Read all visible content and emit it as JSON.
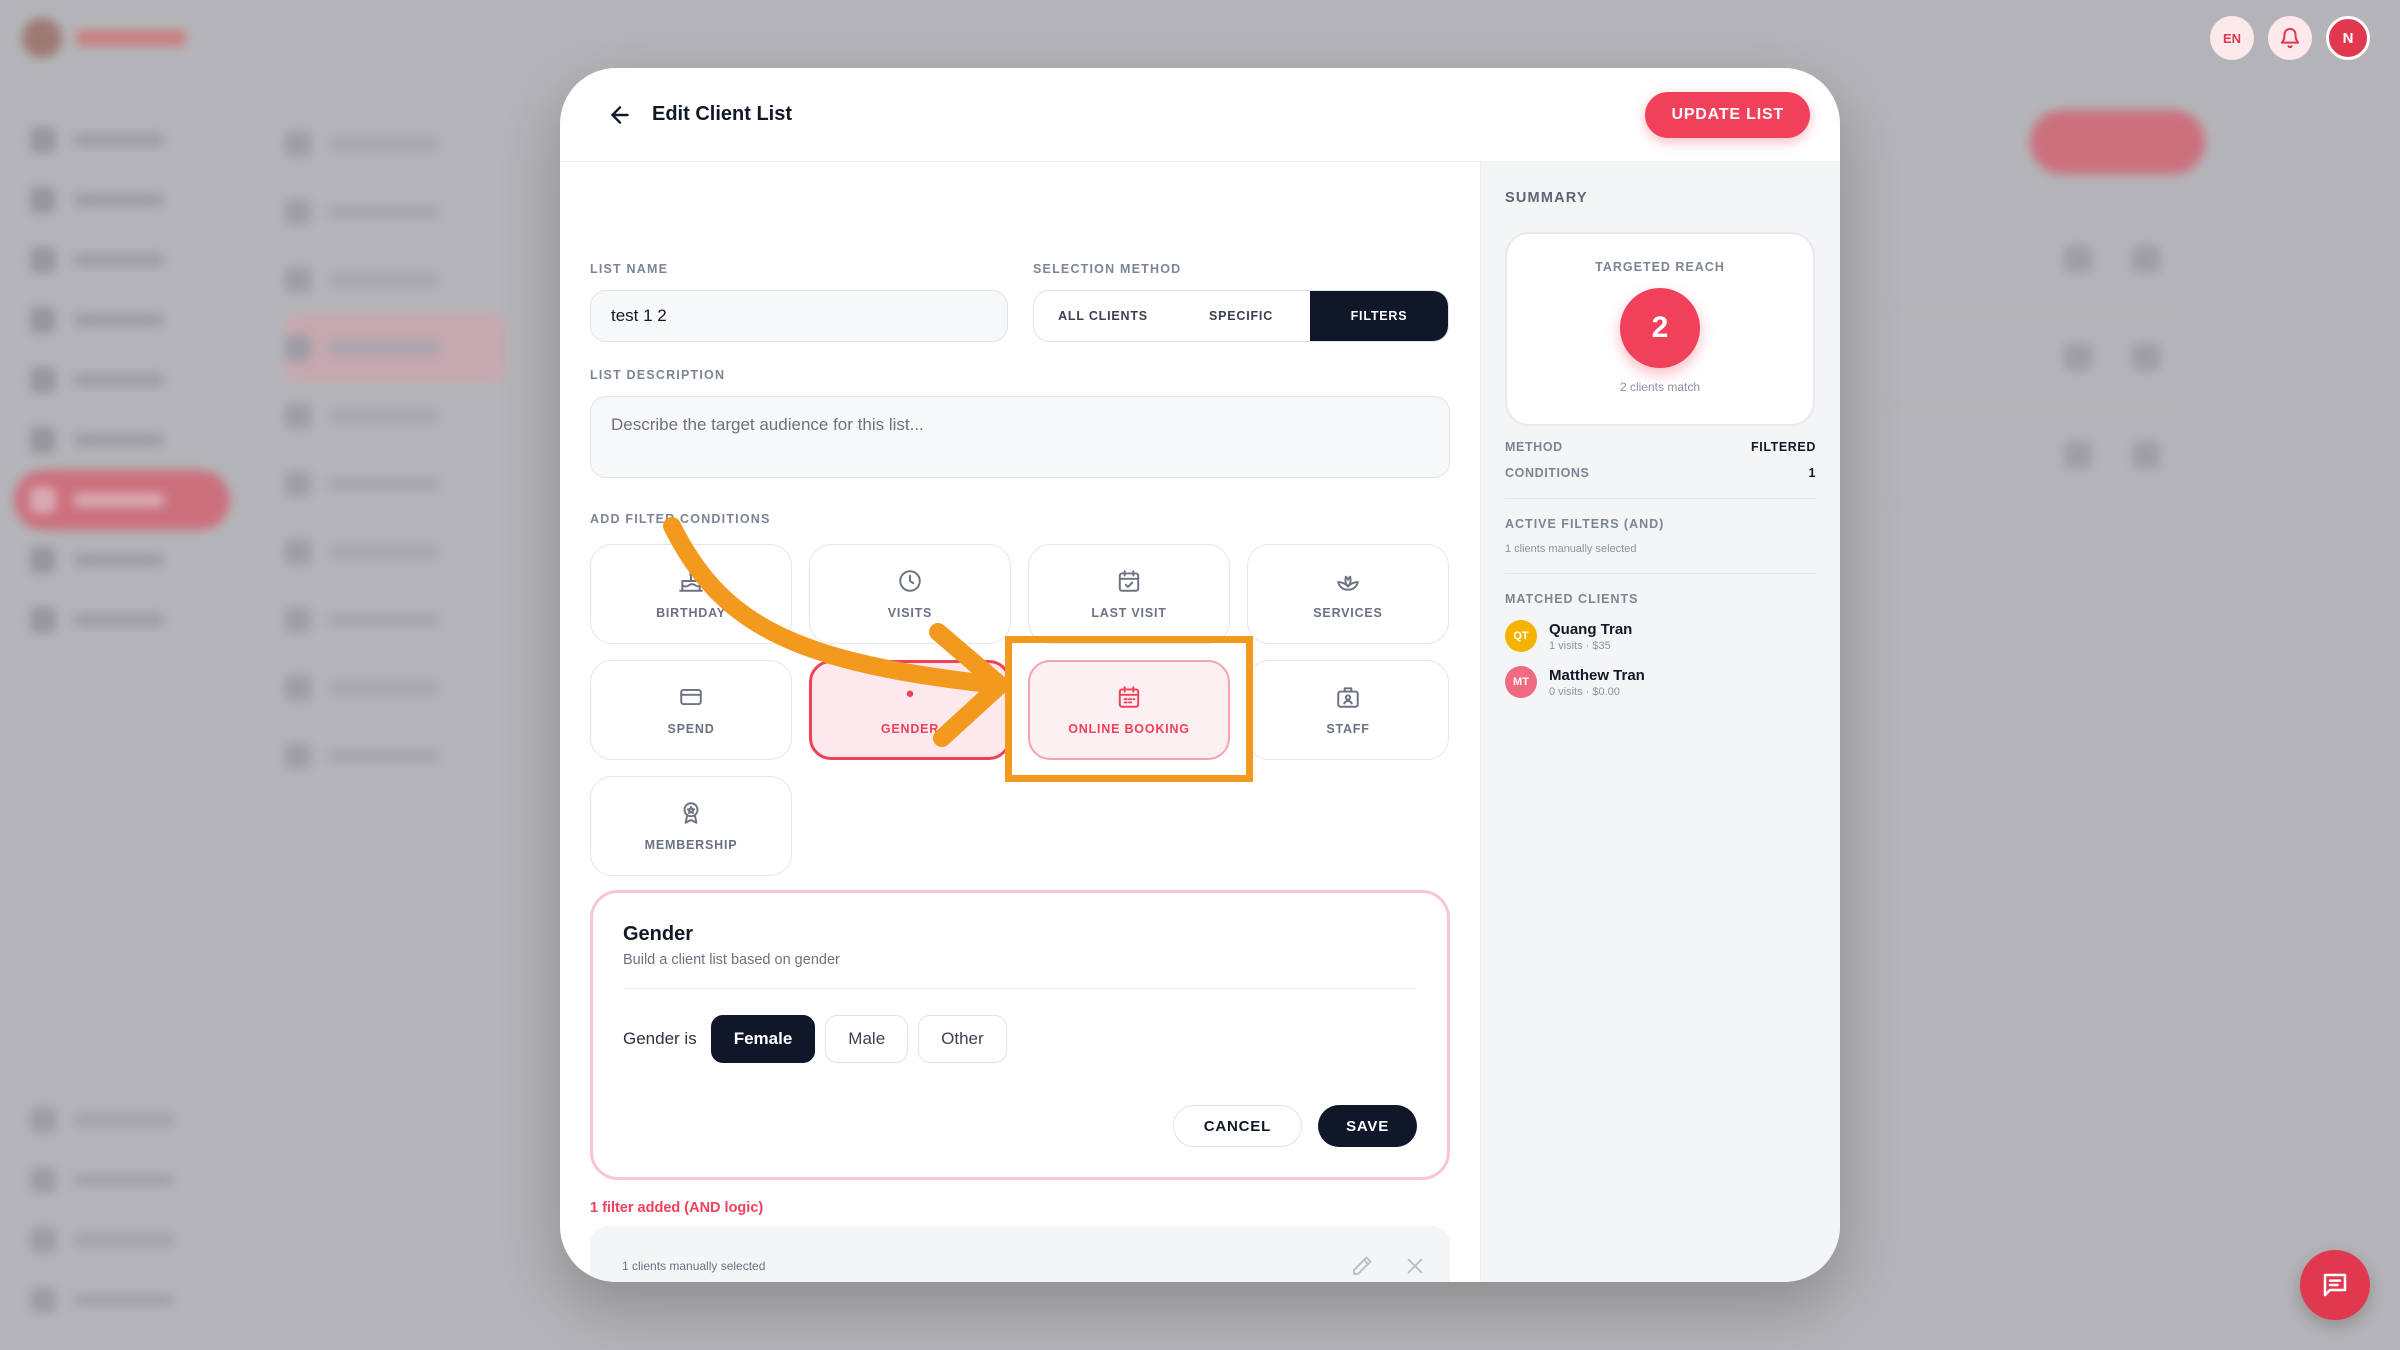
{
  "header": {
    "lang": "EN",
    "user_initial": "N"
  },
  "modal": {
    "title": "Edit Client List",
    "update_button": "UPDATE LIST"
  },
  "form": {
    "list_name_label": "LIST NAME",
    "list_name_value": "test 1 2",
    "selection_method_label": "SELECTION METHOD",
    "selection_methods": [
      "ALL CLIENTS",
      "SPECIFIC",
      "FILTERS"
    ],
    "selected_method": "FILTERS",
    "description_label": "LIST DESCRIPTION",
    "description_placeholder": "Describe the target audience for this list...",
    "add_filter_label": "ADD FILTER CONDITIONS"
  },
  "filter_tiles": [
    {
      "label": "BIRTHDAY",
      "icon": "cake-icon"
    },
    {
      "label": "VISITS",
      "icon": "clock-icon"
    },
    {
      "label": "LAST VISIT",
      "icon": "calendar-check-icon"
    },
    {
      "label": "SERVICES",
      "icon": "lotus-icon"
    },
    {
      "label": "SPEND",
      "icon": "credit-card-icon"
    },
    {
      "label": "GENDER",
      "icon": "gender-icon"
    },
    {
      "label": "ONLINE BOOKING",
      "icon": "calendar-icon"
    },
    {
      "label": "STAFF",
      "icon": "staff-icon"
    },
    {
      "label": "MEMBERSHIP",
      "icon": "badge-icon"
    }
  ],
  "gender_panel": {
    "title": "Gender",
    "subtitle": "Build a client list based on gender",
    "row_label": "Gender is",
    "options": [
      "Female",
      "Male",
      "Other"
    ],
    "selected": "Female",
    "cancel": "CANCEL",
    "save": "SAVE"
  },
  "filters_added": {
    "count_text": "1 filter added (AND logic)",
    "item_text": "1 clients manually selected"
  },
  "summary": {
    "title": "SUMMARY",
    "reach_label": "TARGETED REACH",
    "reach_value": "2",
    "reach_caption": "2 clients match",
    "method_label": "METHOD",
    "method_value": "FILTERED",
    "conditions_label": "CONDITIONS",
    "conditions_value": "1",
    "active_filters_label": "ACTIVE FILTERS (AND)",
    "active_filters_note": "1 clients manually selected",
    "matched_label": "MATCHED CLIENTS",
    "clients": [
      {
        "initials": "QT",
        "name": "Quang Tran",
        "meta": "1 visits · $35",
        "color": "#f5b300"
      },
      {
        "initials": "MT",
        "name": "Matthew Tran",
        "meta": "0 visits · $0.00",
        "color": "#f06a82"
      }
    ]
  },
  "colors": {
    "accent": "#f1405a",
    "dark": "#0f1729",
    "highlight": "#f39a1e"
  }
}
